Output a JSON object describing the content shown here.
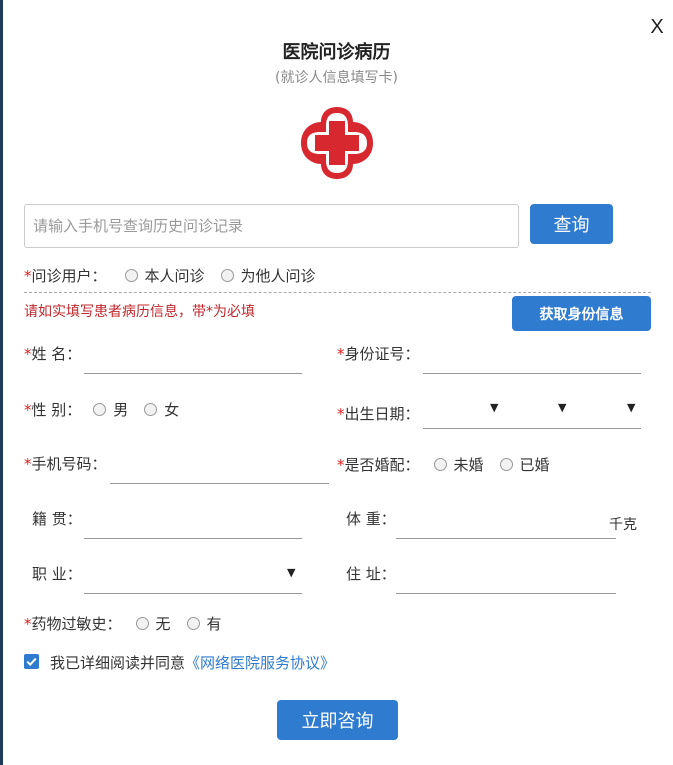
{
  "dialog": {
    "close_label": "X",
    "title": "医院问诊病历",
    "subtitle": "(就诊人信息填写卡)",
    "brand_color": "#d7282f",
    "accent_color": "#2f7bd0"
  },
  "search": {
    "placeholder": "请输入手机号查询历史问诊记录",
    "value": "",
    "button_label": "查询"
  },
  "consult_user": {
    "required_mark": "*",
    "label": "问诊用户：",
    "options": [
      "本人问诊",
      "为他人问诊"
    ]
  },
  "notice": {
    "text": "请如实填写患者病历信息，带*为必填",
    "fetch_button_label": "获取身份信息"
  },
  "fields": {
    "name": {
      "required_mark": "*",
      "label": "姓 名：",
      "value": ""
    },
    "id_number": {
      "required_mark": "*",
      "label": "身份证号：",
      "value": ""
    },
    "gender": {
      "required_mark": "*",
      "label": "性 别：",
      "options": [
        "男",
        "女"
      ]
    },
    "birth_date": {
      "required_mark": "*",
      "label": "出生日期：",
      "arrow": "▼"
    },
    "phone": {
      "required_mark": "*",
      "label": "手机号码：",
      "value": ""
    },
    "married": {
      "required_mark": "*",
      "label": "是否婚配：",
      "options": [
        "未婚",
        "已婚"
      ]
    },
    "hometown": {
      "label": "籍 贯：",
      "value": ""
    },
    "weight": {
      "label": "体 重：",
      "value": "",
      "unit": "千克"
    },
    "occupation": {
      "label": "职 业：",
      "arrow": "▼"
    },
    "address": {
      "label": "住 址：",
      "value": ""
    },
    "allergy": {
      "required_mark": "*",
      "label": "药物过敏史：",
      "options": [
        "无",
        "有"
      ]
    }
  },
  "agreement": {
    "checked": true,
    "text": "我已详细阅读并同意",
    "link_text": "《网络医院服务协议》"
  },
  "submit": {
    "label": "立即咨询"
  }
}
